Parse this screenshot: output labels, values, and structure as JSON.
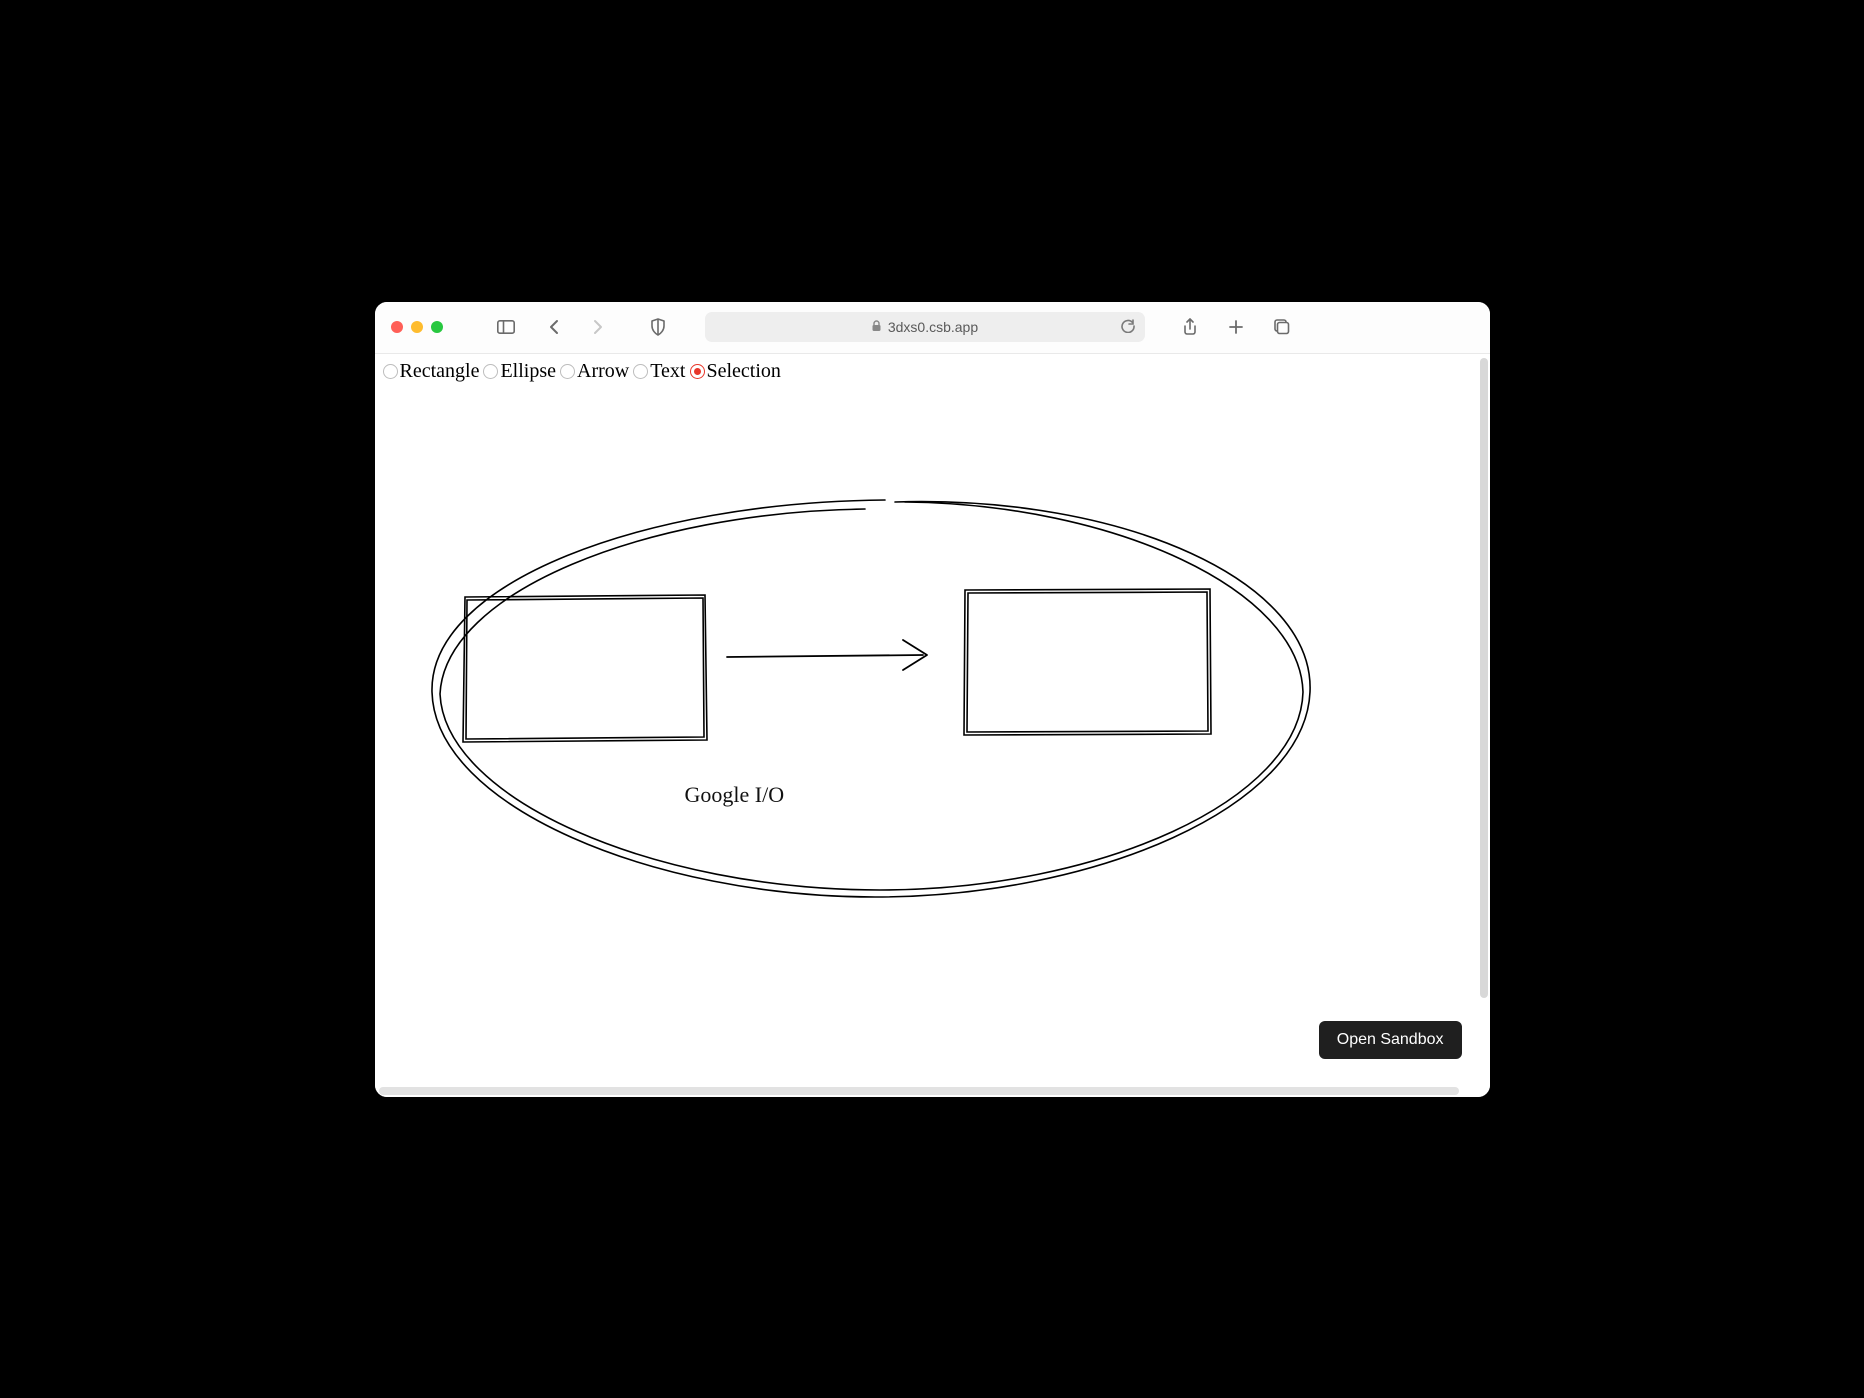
{
  "browser": {
    "url": "3dxs0.csb.app"
  },
  "toolbar": {
    "tools": [
      {
        "id": "rectangle",
        "label": "Rectangle",
        "selected": false
      },
      {
        "id": "ellipse",
        "label": "Ellipse",
        "selected": false
      },
      {
        "id": "arrow",
        "label": "Arrow",
        "selected": false
      },
      {
        "id": "text",
        "label": "Text",
        "selected": false
      },
      {
        "id": "selection",
        "label": "Selection",
        "selected": true
      }
    ]
  },
  "canvas": {
    "text_label": "Google I/O"
  },
  "footer": {
    "open_sandbox_label": "Open Sandbox"
  }
}
